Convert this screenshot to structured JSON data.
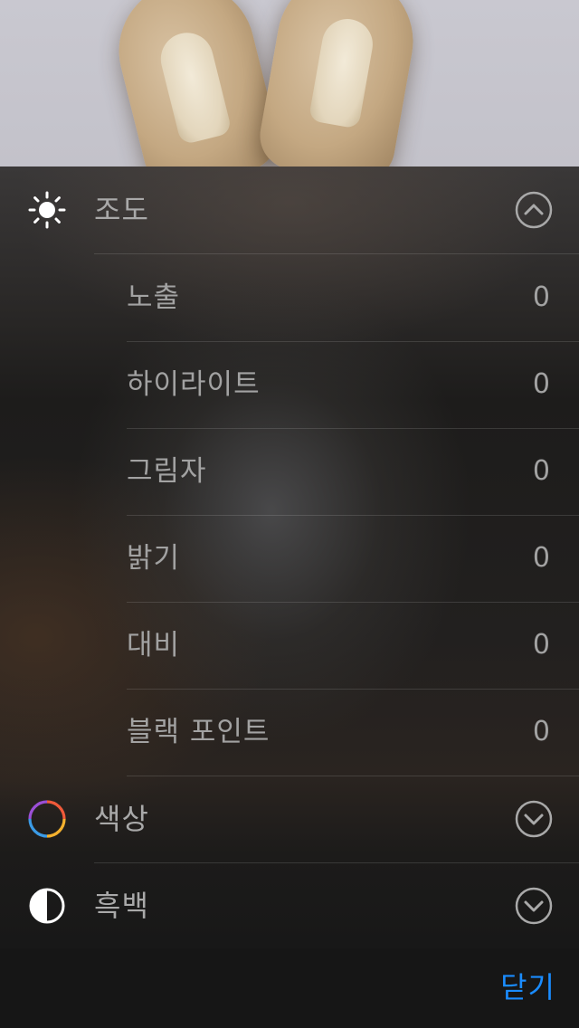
{
  "panel": {
    "sections": {
      "light": {
        "label": "조도",
        "icon": "sun-icon",
        "expanded": true,
        "toggle_icon": "chevron-up-circle-icon"
      },
      "color": {
        "label": "색상",
        "icon": "color-wheel-icon",
        "expanded": false,
        "toggle_icon": "chevron-down-circle-icon"
      },
      "bw": {
        "label": "흑백",
        "icon": "half-circle-contrast-icon",
        "expanded": false,
        "toggle_icon": "chevron-down-circle-icon"
      }
    },
    "light_items": [
      {
        "label": "노출",
        "value": "0"
      },
      {
        "label": "하이라이트",
        "value": "0"
      },
      {
        "label": "그림자",
        "value": "0"
      },
      {
        "label": "밝기",
        "value": "0"
      },
      {
        "label": "대비",
        "value": "0"
      },
      {
        "label": "블랙 포인트",
        "value": "0"
      }
    ]
  },
  "toolbar": {
    "close_label": "닫기"
  },
  "colors": {
    "accent": "#1a8cff",
    "label_text": "#a9a9a9",
    "toolbar_bg": "#161616"
  }
}
